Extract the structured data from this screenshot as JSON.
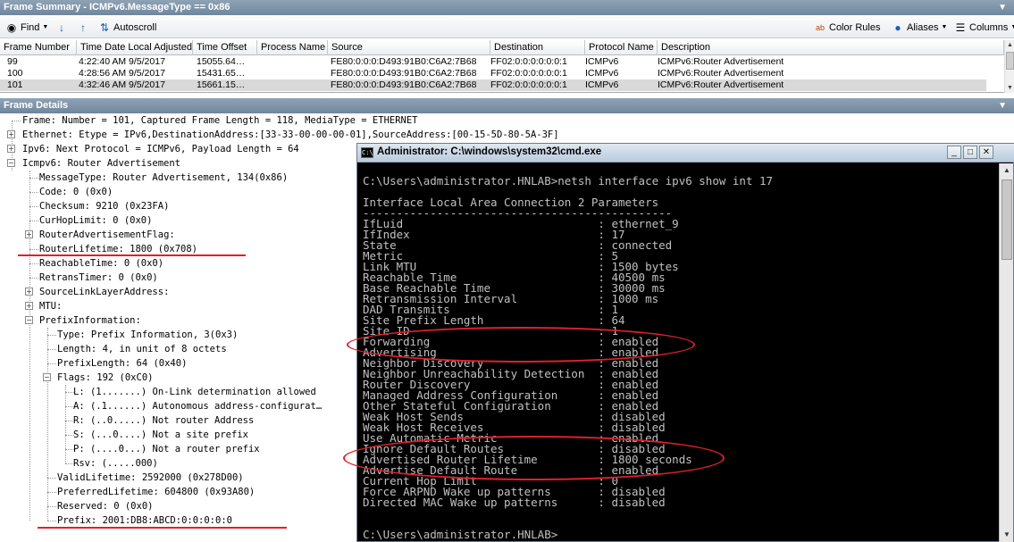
{
  "frame_summary": {
    "title": "Frame Summary - ICMPv6.MessageType == 0x86",
    "toolbar": {
      "find": "Find",
      "autoscroll": "Autoscroll",
      "color_rules": "Color Rules",
      "aliases": "Aliases",
      "columns": "Columns"
    },
    "columns": [
      "Frame Number",
      "Time Date Local Adjusted",
      "Time Offset",
      "Process Name",
      "Source",
      "Destination",
      "Protocol Name",
      "Description"
    ],
    "rows": [
      {
        "frame": "99",
        "time": "4:22:40 AM 9/5/2017",
        "offset": "15055.64…",
        "process": "",
        "source": "FE80:0:0:0:D493:91B0:C6A2:7B68",
        "destination": "FF02:0:0:0:0:0:0:1",
        "protocol": "ICMPv6",
        "description": "ICMPv6:Router Advertisement"
      },
      {
        "frame": "100",
        "time": "4:28:56 AM 9/5/2017",
        "offset": "15431.65…",
        "process": "",
        "source": "FE80:0:0:0:D493:91B0:C6A2:7B68",
        "destination": "FF02:0:0:0:0:0:0:1",
        "protocol": "ICMPv6",
        "description": "ICMPv6:Router Advertisement"
      },
      {
        "frame": "101",
        "time": "4:32:46 AM 9/5/2017",
        "offset": "15661.15…",
        "process": "",
        "source": "FE80:0:0:0:D493:91B0:C6A2:7B68",
        "destination": "FF02:0:0:0:0:0:0:1",
        "protocol": "ICMPv6",
        "description": "ICMPv6:Router Advertisement"
      }
    ]
  },
  "frame_details": {
    "title": "Frame Details",
    "nodes": [
      "Frame: Number = 101, Captured Frame Length = 118, MediaType = ETHERNET",
      "Ethernet: Etype = IPv6,DestinationAddress:[33-33-00-00-00-01],SourceAddress:[00-15-5D-80-5A-3F]",
      "Ipv6: Next Protocol = ICMPv6, Payload Length = 64",
      "Icmpv6: Router Advertisement",
      "MessageType: Router Advertisement, 134(0x86)",
      "Code: 0 (0x0)",
      "Checksum: 9210 (0x23FA)",
      "CurHopLimit: 0 (0x0)",
      "RouterAdvertisementFlag:",
      "RouterLifetime: 1800 (0x708)",
      "ReachableTime: 0 (0x0)",
      "RetransTimer: 0 (0x0)",
      "SourceLinkLayerAddress:",
      "MTU:",
      "PrefixInformation:",
      "Type: Prefix Information, 3(0x3)",
      "Length: 4, in unit of 8 octets",
      "PrefixLength: 64 (0x40)",
      "Flags: 192 (0xC0)",
      "L:   (1.......) On-Link determination allowed",
      "A:   (.1......) Autonomous address-configurat…",
      "R:   (..0.....) Not router Address",
      "S:   (...0....) Not a site prefix",
      "P:   (....0...) Not a router prefix",
      "Rsv: (.....000)",
      "ValidLifetime: 2592000 (0x278D00)",
      "PreferredLifetime: 604800 (0x93A80)",
      "Reserved: 0 (0x0)",
      "Prefix: 2001:DB8:ABCD:0:0:0:0:0"
    ]
  },
  "cmd": {
    "title": "Administrator: C:\\windows\\system32\\cmd.exe",
    "lines": [
      "",
      "C:\\Users\\administrator.HNLAB>netsh interface ipv6 show int 17",
      "",
      "Interface Local Area Connection 2 Parameters",
      "----------------------------------------------",
      "IfLuid                             : ethernet_9",
      "IfIndex                            : 17",
      "State                              : connected",
      "Metric                             : 5",
      "Link MTU                           : 1500 bytes",
      "Reachable Time                     : 40500 ms",
      "Base Reachable Time                : 30000 ms",
      "Retransmission Interval            : 1000 ms",
      "DAD Transmits                      : 1",
      "Site Prefix Length                 : 64",
      "Site ID                            : 1",
      "Forwarding                         : enabled",
      "Advertising                        : enabled",
      "Neighbor Discovery                 : enabled",
      "Neighbor Unreachability Detection  : enabled",
      "Router Discovery                   : enabled",
      "Managed Address Configuration      : enabled",
      "Other Stateful Configuration       : enabled",
      "Weak Host Sends                    : disabled",
      "Weak Host Receives                 : disabled",
      "Use Automatic Metric               : enabled",
      "Ignore Default Routes              : disabled",
      "Advertised Router Lifetime         : 1800 seconds",
      "Advertise Default Route            : enabled",
      "Current Hop Limit                  : 0",
      "Force ARPND Wake up patterns       : disabled",
      "Directed MAC Wake up patterns      : disabled",
      "",
      "",
      "C:\\Users\\administrator.HNLAB>"
    ]
  },
  "colors": {
    "annotation": "#e0202a",
    "pane_header": "#7b90a5",
    "selected_row": "#d9d9d9"
  }
}
